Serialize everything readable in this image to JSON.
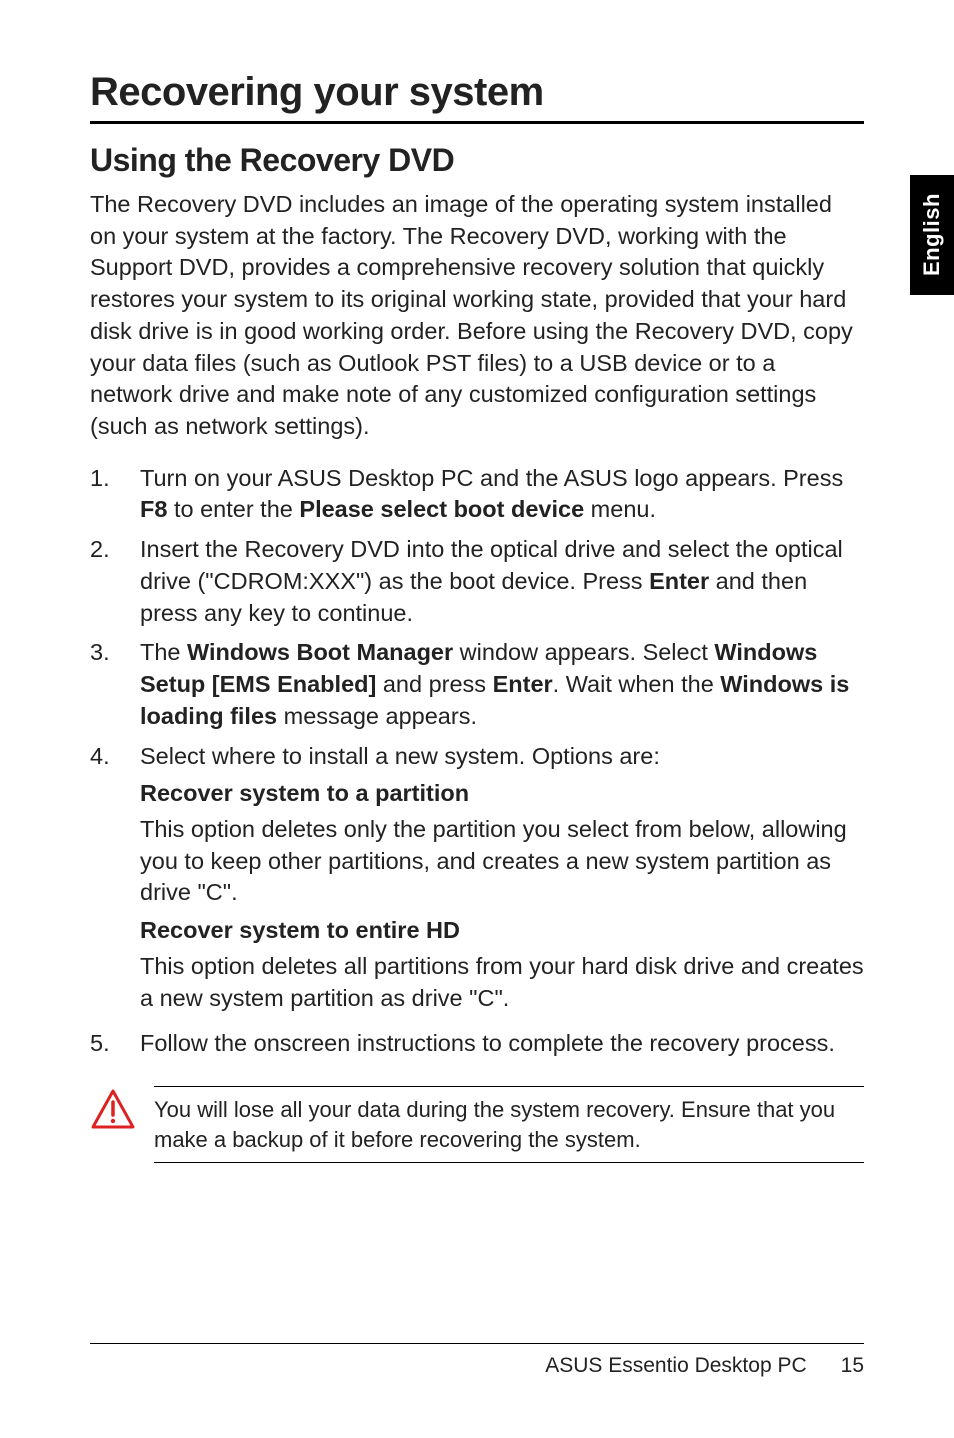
{
  "sideTab": "English",
  "chapterTitle": "Recovering your system",
  "sectionTitle": "Using the Recovery DVD",
  "intro": "The Recovery DVD includes an image of the operating system installed on your system at the factory. The Recovery DVD, working with the Support DVD, provides a comprehensive recovery solution that quickly restores your system to its original working state, provided that your hard disk drive is in good working order. Before using the Recovery DVD, copy your data files (such as Outlook PST files) to a USB device or to a network drive and make note of any customized configuration settings (such as network settings).",
  "steps": [
    {
      "num": "1.",
      "parts": [
        {
          "t": "Turn on your ASUS Desktop PC and the ASUS logo appears. Press "
        },
        {
          "t": "F8",
          "b": true
        },
        {
          "t": " to enter the "
        },
        {
          "t": "Please select boot device",
          "b": true
        },
        {
          "t": " menu."
        }
      ]
    },
    {
      "num": "2.",
      "parts": [
        {
          "t": "Insert the Recovery DVD into the optical drive and select the optical drive (\"CDROM:XXX\") as the boot device. Press "
        },
        {
          "t": "Enter",
          "b": true
        },
        {
          "t": " and then press any key to continue."
        }
      ]
    },
    {
      "num": "3.",
      "parts": [
        {
          "t": "The "
        },
        {
          "t": "Windows Boot Manager",
          "b": true
        },
        {
          "t": " window appears. Select "
        },
        {
          "t": "Windows Setup [EMS Enabled]",
          "b": true
        },
        {
          "t": " and press "
        },
        {
          "t": "Enter",
          "b": true
        },
        {
          "t": ". Wait when the "
        },
        {
          "t": "Windows is loading files",
          "b": true
        },
        {
          "t": " message appears."
        }
      ]
    },
    {
      "num": "4.",
      "parts": [
        {
          "t": "Select where to install a new system. Options are:"
        }
      ],
      "sub": [
        {
          "head": "Recover system to a partition",
          "body": "This option deletes only the partition you select from below, allowing you to keep other partitions, and creates a new system partition as drive \"C\"."
        },
        {
          "head": "Recover system to entire HD",
          "body": "This option deletes all partitions from your hard disk drive and creates a new system partition as drive \"C\"."
        }
      ]
    },
    {
      "num": "5.",
      "parts": [
        {
          "t": "Follow the onscreen instructions to complete the recovery process."
        }
      ]
    }
  ],
  "warningText": "You will lose all your data during the system recovery. Ensure that you make a backup of it before recovering the system.",
  "footer": {
    "product": "ASUS Essentio Desktop PC",
    "page": "15"
  }
}
